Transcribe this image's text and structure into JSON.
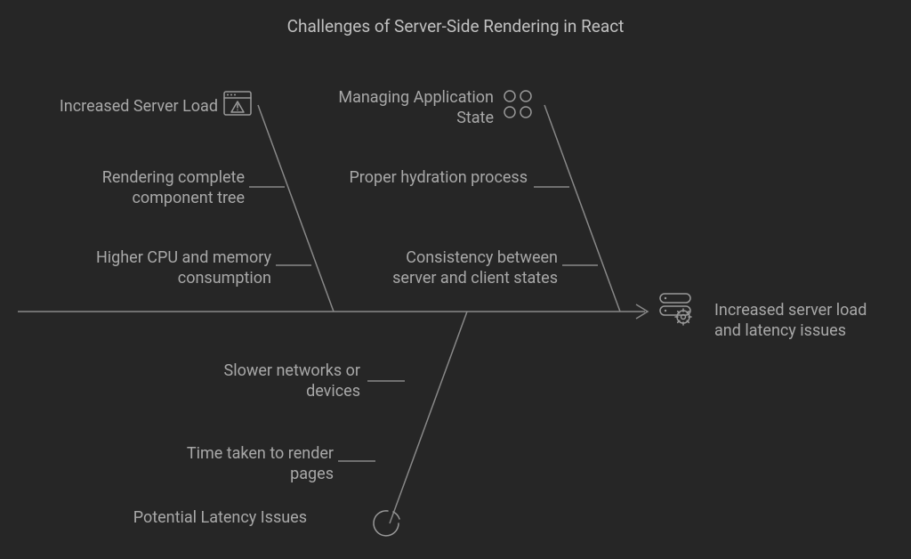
{
  "title": "Challenges of Server-Side Rendering in React",
  "result": "Increased server load and latency issues",
  "branches": {
    "topLeft": {
      "category": "Increased Server Load",
      "items": [
        "Rendering complete component tree",
        "Higher CPU and memory consumption"
      ]
    },
    "topRight": {
      "category": "Managing Application State",
      "items": [
        "Proper hydration process",
        "Consistency between server and client states"
      ]
    },
    "bottom": {
      "category": "Potential Latency Issues",
      "items": [
        "Slower networks or devices",
        "Time taken to render pages"
      ]
    }
  }
}
